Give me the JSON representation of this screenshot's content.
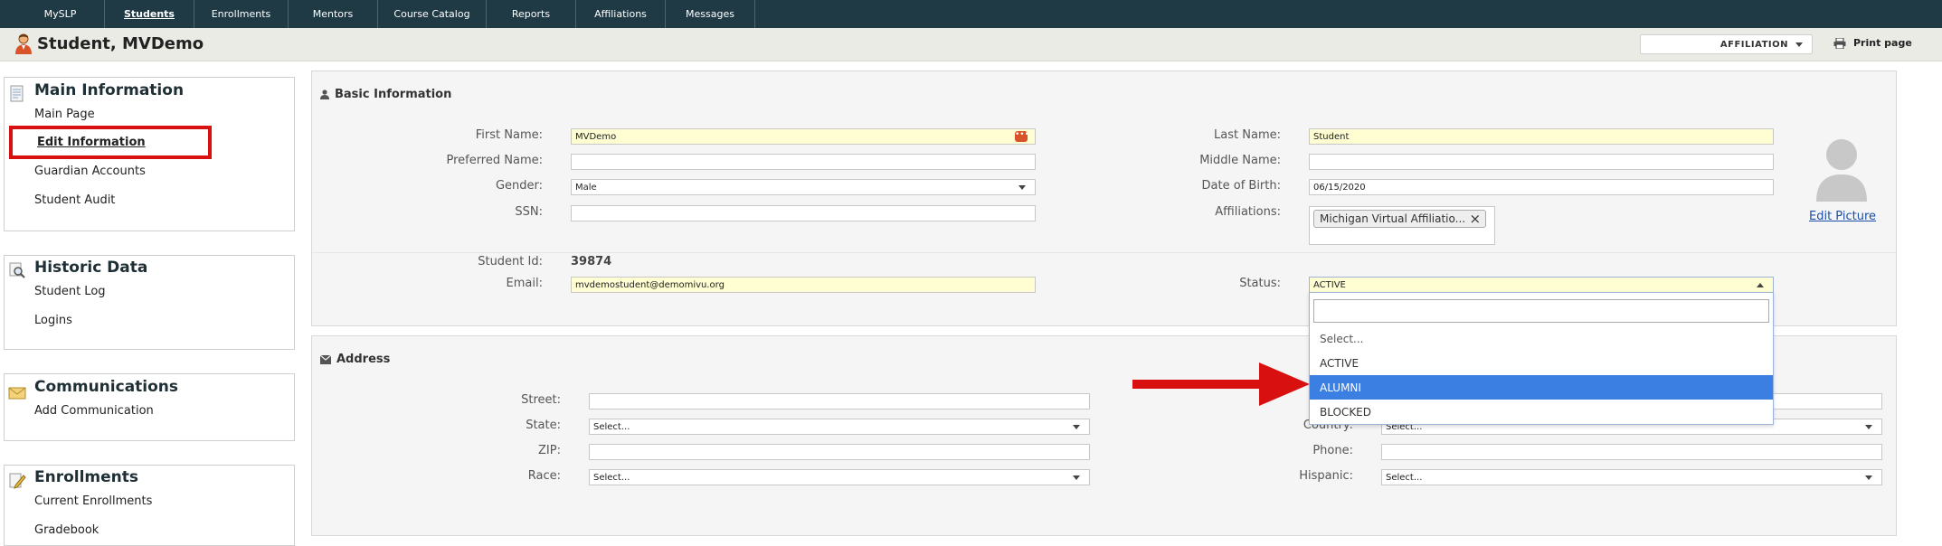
{
  "nav": {
    "tabs": [
      {
        "label": "MySLP"
      },
      {
        "label": "Students"
      },
      {
        "label": "Enrollments"
      },
      {
        "label": "Mentors"
      },
      {
        "label": "Course Catalog"
      },
      {
        "label": "Reports"
      },
      {
        "label": "Affiliations"
      },
      {
        "label": "Messages"
      }
    ],
    "active": "Students"
  },
  "header": {
    "title": "Student, MVDemo",
    "affiliation_select": "AFFILIATION",
    "print_label": "Print page"
  },
  "sidebar": {
    "main": {
      "title": "Main Information",
      "items": [
        "Main Page",
        "Edit Information",
        "Guardian Accounts",
        "Student Audit"
      ]
    },
    "historic": {
      "title": "Historic Data",
      "items": [
        "Student Log",
        "Logins"
      ]
    },
    "communications": {
      "title": "Communications",
      "items": [
        "Add Communication"
      ]
    },
    "enrollments": {
      "title": "Enrollments",
      "items": [
        "Current Enrollments",
        "Gradebook"
      ]
    }
  },
  "basic": {
    "heading": "Basic Information",
    "first_name_label": "First Name:",
    "first_name_value": "MVDemo",
    "preferred_name_label": "Preferred Name:",
    "preferred_name_value": "",
    "gender_label": "Gender:",
    "gender_value": "Male",
    "ssn_label": "SSN:",
    "ssn_value": "",
    "last_name_label": "Last Name:",
    "last_name_value": "Student",
    "middle_name_label": "Middle Name:",
    "middle_name_value": "",
    "dob_label": "Date of Birth:",
    "dob_value": "06/15/2020",
    "affiliations_label": "Affiliations:",
    "affiliation_chip": "Michigan Virtual Affiliatio...",
    "student_id_label": "Student Id:",
    "student_id_value": "39874",
    "email_label": "Email:",
    "email_value": "mvdemostudent@demomivu.org",
    "status_label": "Status:",
    "status_value": "ACTIVE",
    "edit_picture": "Edit Picture"
  },
  "status_dropdown": {
    "search_value": "",
    "options": [
      "Select...",
      "ACTIVE",
      "ALUMNI",
      "BLOCKED"
    ],
    "highlighted": "ALUMNI"
  },
  "address": {
    "heading": "Address",
    "street_label": "Street:",
    "street_value": "",
    "state_label": "State:",
    "state_value": "Select...",
    "zip_label": "ZIP:",
    "zip_value": "",
    "race_label": "Race:",
    "race_value": "Select...",
    "country_label": "Country:",
    "country_value": "Select...",
    "phone_label": "Phone:",
    "phone_value": "",
    "hispanic_label": "Hispanic:",
    "hispanic_value": "Select..."
  },
  "colors": {
    "nav_bg": "#1f3a45",
    "highlight": "#3b7fe3",
    "annotation_red": "#d81010",
    "required_yellow": "#fffdd2"
  }
}
